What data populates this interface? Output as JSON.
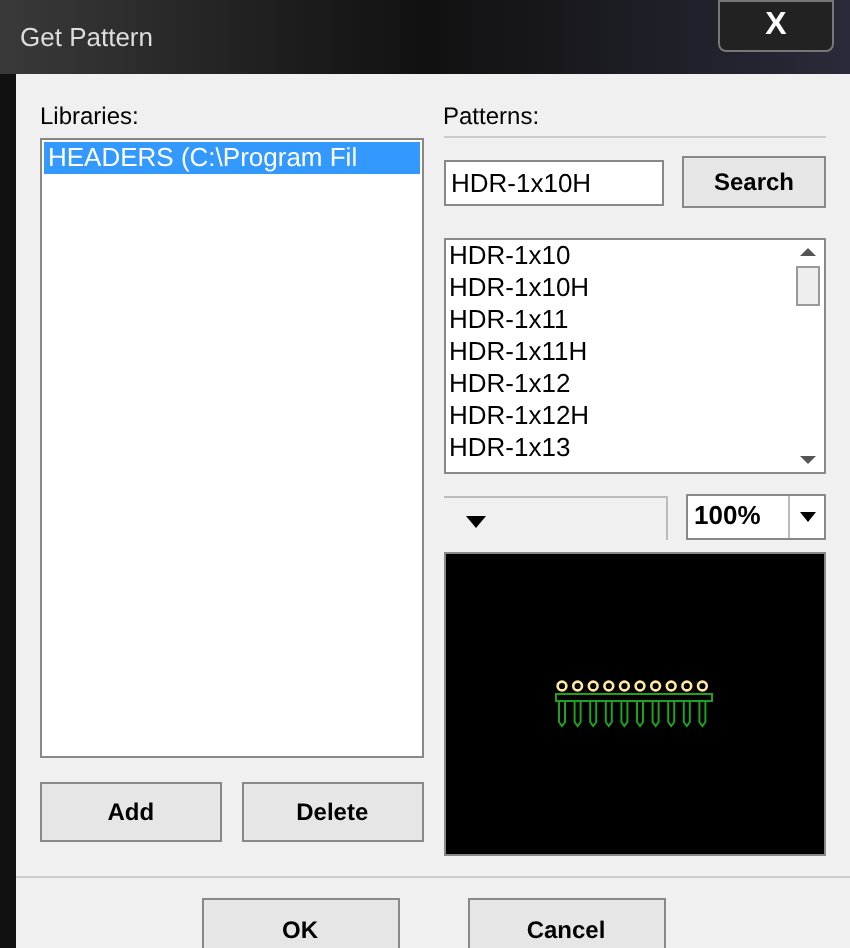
{
  "window": {
    "title": "Get Pattern",
    "close": "X"
  },
  "libraries": {
    "label": "Libraries:",
    "items": [
      {
        "text": "HEADERS (C:\\Program Fil",
        "selected": true
      }
    ],
    "buttons": [
      "Add",
      "Delete"
    ]
  },
  "patterns": {
    "label": "Patterns:",
    "search": {
      "value": "HDR-1x10H",
      "button": "Search"
    },
    "items": [
      "HDR-1x10",
      "HDR-1x10H",
      "HDR-1x11",
      "HDR-1x11H",
      "HDR-1x12",
      "HDR-1x12H",
      "HDR-1x13"
    ],
    "zoom_slider": {
      "level": 0.15
    },
    "zoom": "100%"
  },
  "buttons": [
    "OK",
    "Cancel"
  ]
}
